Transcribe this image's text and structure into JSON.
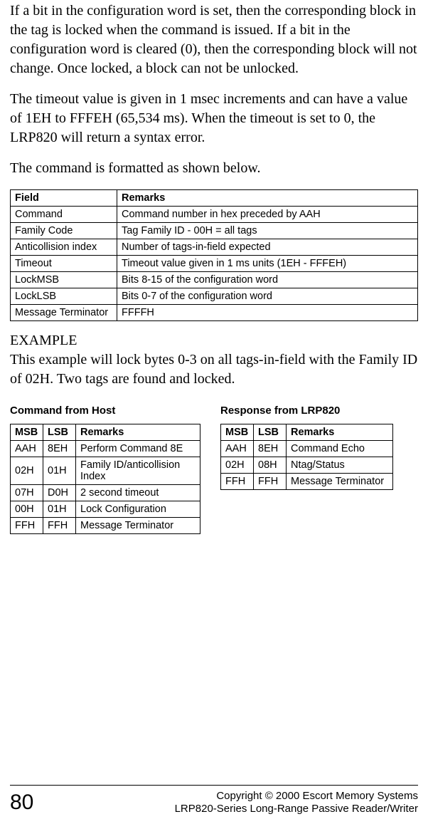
{
  "paragraphs": {
    "p1": "If a bit in the configuration word is set, then the corresponding block in the tag is locked when the command is issued. If a bit in the configuration word is cleared (0), then the corresponding block will not change. Once locked, a block can not be unlocked.",
    "p2": "The timeout value is given in 1 msec increments  and can have a value of 1EH to FFFEH (65,534 ms). When the timeout is set to 0, the LRP820 will return a syntax error.",
    "p3": "The command is formatted as shown below."
  },
  "fieldTable": {
    "headers": {
      "c0": "Field",
      "c1": "Remarks"
    },
    "rows": [
      {
        "c0": "Command",
        "c1": "Command number in hex preceded by AAH"
      },
      {
        "c0": "Family Code",
        "c1": "Tag Family ID - 00H = all tags"
      },
      {
        "c0": "Anticollision index",
        "c1": "Number of tags-in-field expected"
      },
      {
        "c0": "Timeout",
        "c1": "Timeout value given in 1 ms units (1EH - FFFEH)"
      },
      {
        "c0": "LockMSB",
        "c1": "Bits 8-15 of the configuration word"
      },
      {
        "c0": "LockLSB",
        "c1": "Bits 0-7 of the configuration word"
      },
      {
        "c0": "Message Terminator",
        "c1": "FFFFH"
      }
    ]
  },
  "example": {
    "label": "EXAMPLE",
    "text": "This example will lock bytes 0-3 on all tags-in-field with the Family ID of 02H. Two tags are found and locked."
  },
  "hostTable": {
    "title": "Command from Host",
    "headers": {
      "c0": "MSB",
      "c1": "LSB",
      "c2": "Remarks"
    },
    "rows": [
      {
        "c0": "AAH",
        "c1": "8EH",
        "c2": "Perform Command 8E"
      },
      {
        "c0": "02H",
        "c1": "01H",
        "c2": "Family ID/anticollision Index"
      },
      {
        "c0": "07H",
        "c1": "D0H",
        "c2": "2 second timeout"
      },
      {
        "c0": "00H",
        "c1": "01H",
        "c2": "Lock Configuration"
      },
      {
        "c0": "FFH",
        "c1": "FFH",
        "c2": "Message Terminator"
      }
    ]
  },
  "respTable": {
    "title": "Response from LRP820",
    "headers": {
      "c0": "MSB",
      "c1": "LSB",
      "c2": "Remarks"
    },
    "rows": [
      {
        "c0": "AAH",
        "c1": "8EH",
        "c2": "Command Echo"
      },
      {
        "c0": "02H",
        "c1": "08H",
        "c2": "Ntag/Status"
      },
      {
        "c0": "FFH",
        "c1": "FFH",
        "c2": "Message Terminator"
      }
    ]
  },
  "footer": {
    "pageNum": "80",
    "line1": "Copyright © 2000 Escort Memory Systems",
    "line2": "LRP820-Series Long-Range Passive Reader/Writer"
  }
}
